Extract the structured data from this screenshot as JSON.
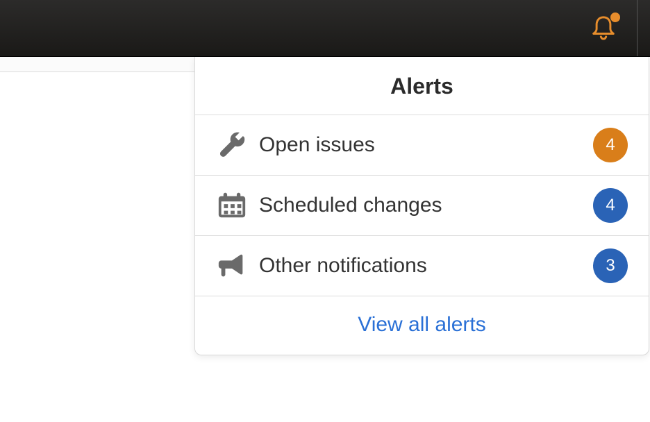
{
  "colors": {
    "badge_orange": "#d97e1a",
    "badge_blue": "#2a63b6",
    "link": "#2a70d6",
    "bell": "#e78d2c"
  },
  "notifications": {
    "panel_title": "Alerts",
    "items": [
      {
        "icon": "wrench-icon",
        "label": "Open issues",
        "count": "4",
        "badge_color": "orange"
      },
      {
        "icon": "calendar-icon",
        "label": "Scheduled changes",
        "count": "4",
        "badge_color": "blue"
      },
      {
        "icon": "megaphone-icon",
        "label": "Other notifications",
        "count": "3",
        "badge_color": "blue"
      }
    ],
    "footer_link": "View all alerts",
    "bell_has_indicator": true
  }
}
